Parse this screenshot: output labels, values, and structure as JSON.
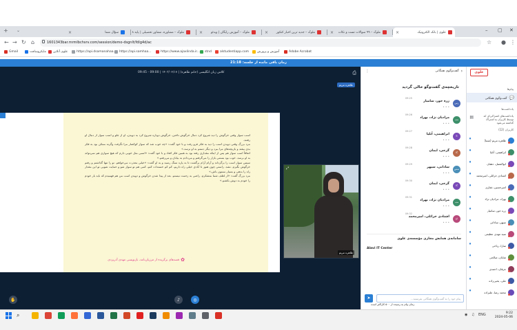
{
  "browser": {
    "tabs": [
      {
        "label": "سؤال شما",
        "favicon_color": "#1a73e8",
        "active": false
      },
      {
        "label": "ملوک – مشاوره، مشاور تحصیلی | پایه ۸ | ...",
        "favicon_color": "#d33",
        "active": false
      },
      {
        "label": "ملوک – آموزش رایگان | ویدئو",
        "favicon_color": "#d33",
        "active": false
      },
      {
        "label": "ملوک – جدید ترین اخبار کنکور",
        "favicon_color": "#d33",
        "active": false
      },
      {
        "label": "ملوک – ۹۹ سوالات تست و نکات",
        "favicon_color": "#d33",
        "active": false
      },
      {
        "label": "علوی | بانک الکترونیک",
        "favicon_color": "#d33",
        "active": true
      }
    ],
    "url": "1601343bar.mrmlbchsrv.com/session/demo-dsgnlt/fdlg4d/ac",
    "bookmarks": [
      {
        "label": "Gmail",
        "color": "#d93025"
      },
      {
        "label": "مایکروسافت",
        "color": "#1a73e8"
      },
      {
        "label": "علوی آنلاین",
        "color": "#d33"
      },
      {
        "label": "https://api.dsamanahaa...",
        "color": "#9aa0a6"
      },
      {
        "label": "https://api.samhaa...",
        "color": "#9aa0a6"
      },
      {
        "label": "https://www.ajaxlinda.ir...",
        "color": "#d33"
      },
      {
        "label": "stnd",
        "color": "#34a853"
      },
      {
        "label": "alstudentiapp.com",
        "color": "#ea4335"
      },
      {
        "label": "آموزش و پرورش",
        "color": "#fbbc04"
      },
      {
        "label": "Adobe Acrobat",
        "color": "#d93025"
      }
    ]
  },
  "session": {
    "time_left": "زمان باقی مانده از جلسه: 21:18"
  },
  "stage": {
    "title": "کلاس زبان انگلیسی (خانم طاهره) | ۱۴۰۳/۰۲/۱۷ | 09:00 - 09:45",
    "presenter": "طاهره مریم",
    "webcam_label": "طاهره مریم",
    "slide": {
      "paragraphs": [
        "اسب سوار وقتی خرگوش را دید شروع کرد دنبال خرگوش تاختن. خرگوش دوباره شروع کرد به دویدن، او از جلو و اسب سوار از دنبال او رفتند.",
        "مرد بزرگ وقتی دویدن اسب را دید به فکر فرو رفت و با خود گفت: «چه خوب شد که سوار کوکصار مرا نگرفت وگرنه ممکن بود به فکر بدی بیفتد و بازیچه‌های مرا ببرد و دیگر دستم به او نرسد.»",
        "اتفاقاً اسب سوار هم پس از اینکه مقداری رفته بود به همین فکر افتاد و با خود گفت: «اسبی مثل خوبی دارم که هیچ سواری هم نمی‌تواند به او برسد. خوب بود بستنی بازار را می‌گرفتم و می‌دادم به بیابان و می‌رفتم.»",
        "سپس سوار اسب را برگرداند و آرام آرام برگشت تا به پاره سنگ رسید و به او گفت: «خیلی معذرت می‌خواهم. تو را تنها گذاشتم و رفتم خرگوش بگیرم. نشد. راستی چون هنوز تا آبادی خیلی راه داریم، کم کم خسته‌ات کنم، کمی هم تو سوار شو و حمایت شویی تو این مقدار راه را بدهی و بسیار ممنون باش.»",
        "مرد بزرگ گفت: «از لطف شما متشکرم. راضی به زحمت نیستم. بعد از پیدا شدن خرگوش و دویدن اسب من هم فهمیدم که باید بار خودم را خودم به دوش بکشم.»"
      ],
      "footer": "قصه‌های برگزیده از مرزبان‌نامه، بازنویسی مهدی آذریزدی"
    }
  },
  "chat": {
    "header": "گفت‌وگوی همگانی",
    "title": "تاریخچه‌ی گفت‌وگو خالی گردید",
    "messages": [
      {
        "name": "زره حور، سامیار",
        "time": "09:25",
        "initials": "زس"
      },
      {
        "name": "مرادیان نژاد، بهراد",
        "time": "09:26",
        "initials": "مب"
      },
      {
        "name": "ابراهیمی، آنلیا",
        "time": "09:27",
        "initials": "اآ"
      },
      {
        "name": "گرجی، ایمان",
        "time": "09:28",
        "initials": "گا"
      },
      {
        "name": "ساداتی، سپهر",
        "time": "09:29",
        "initials": "سس"
      },
      {
        "name": "گرجی، ایمان",
        "time": "09:30",
        "initials": "گا"
      },
      {
        "name": "مرادیان نژاد، بهراد",
        "time": "09:31",
        "initials": "مب"
      },
      {
        "name": "اشتادی خزائلی، امیرمحمد",
        "time": "09:32",
        "initials": "اخ"
      }
    ],
    "sponsor": "سامانه‌ی همایش مجازی مؤسسه‌ی علوی",
    "sponsor_brand": "Alavi IT Center",
    "input_placeholder": "پیام خود را به گفت‌وگوی همگانی بفرستید...",
    "warning": "زمان پیام به رسیده از ۵۰۰ کاراکتر است"
  },
  "sidebar": {
    "logo": "علوی",
    "section_messages": "پیام‌ها",
    "public_chat": "گفت‌وگوی همگانی",
    "section_notes": "یادداشت‌ها",
    "notes_notice": "یادداشت‌های اشتراکی‌ای که توسط کاربران به اشتراک گذاشته می‌شود",
    "section_users": "کاربران (12)",
    "users": [
      "طاهره مریم (شما)",
      "ابراهیمی، آنلیا",
      "ابوالفضل، دهقان",
      "اشتادی خزائلی، امیرمحمد",
      "امیرحسین، غفاری",
      "بهراد، مرادیان نژاد",
      "زره حور، سامیار",
      "سپهر، ساداتی",
      "سید مهدی عظیمی",
      "سارا، ریاحی",
      "شایان، صالحی",
      "عرفان، احمدی",
      "علی، یحیی‌زاده",
      "محمد رضا، علیزاده"
    ]
  },
  "taskbar": {
    "time": "9:22",
    "date": "2024-05-06",
    "lang": "ENG",
    "apps": [
      {
        "name": "file-explorer",
        "color": "#f4b400"
      },
      {
        "name": "chrome",
        "color": "#db4437"
      },
      {
        "name": "edge",
        "color": "#0f9d58"
      },
      {
        "name": "firefox",
        "color": "#ff7139"
      },
      {
        "name": "store",
        "color": "#3367d6"
      },
      {
        "name": "word",
        "color": "#2b579a"
      },
      {
        "name": "excel",
        "color": "#217346"
      },
      {
        "name": "powerpoint",
        "color": "#d24726"
      },
      {
        "name": "acrobat",
        "color": "#e02020"
      },
      {
        "name": "photoshop",
        "color": "#1b3a5c"
      },
      {
        "name": "vlc",
        "color": "#f08c00"
      },
      {
        "name": "paint",
        "color": "#9c27b0"
      },
      {
        "name": "files",
        "color": "#607d8b"
      },
      {
        "name": "settings",
        "color": "#5f6368"
      },
      {
        "name": "record",
        "color": "#d93025"
      }
    ]
  }
}
